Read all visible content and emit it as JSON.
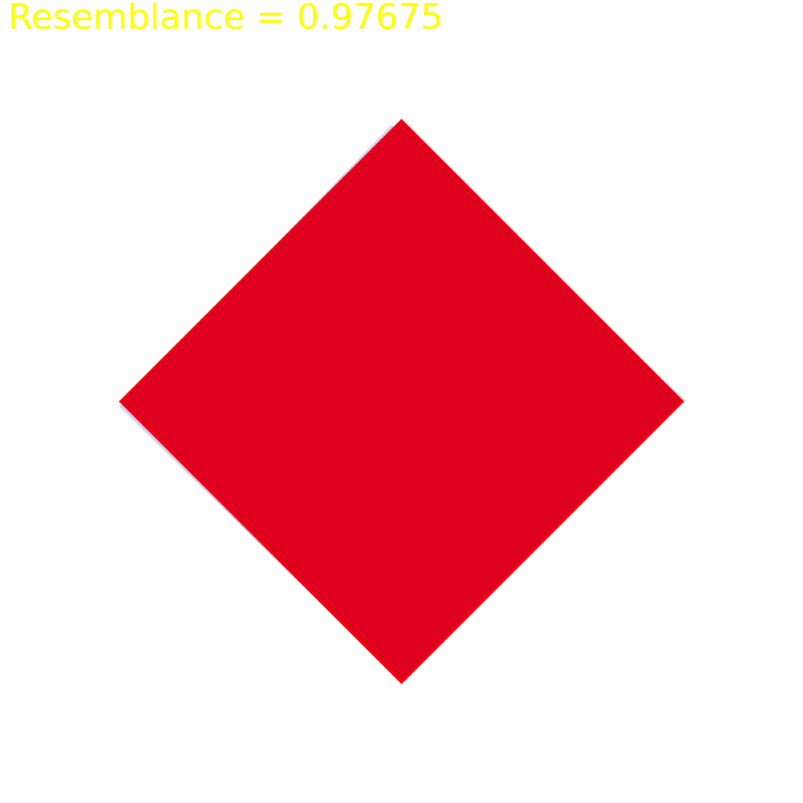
{
  "header": {
    "score_text": "Resemblance = 0.97675"
  },
  "colors": {
    "background": "#ffffff",
    "score_text": "#ffff00",
    "target_shape_outline": "#ff0000",
    "reference_shape_tint": "#d8d0f8",
    "overlap_fill": "#df0020"
  },
  "shapes": {
    "reference": {
      "shape": "diamond",
      "role": "reference"
    },
    "target": {
      "shape": "diamond",
      "role": "target"
    }
  }
}
